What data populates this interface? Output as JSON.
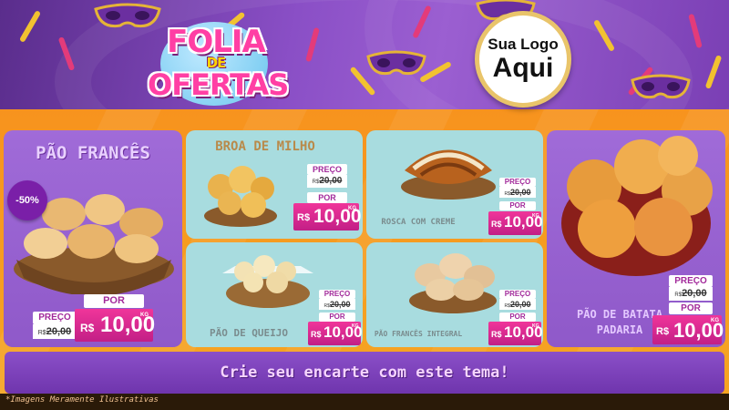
{
  "header": {
    "title_line1": "FOLIA",
    "title_line2": "DE",
    "title_line3": "OFERTAS",
    "logo_line1": "Sua Logo",
    "logo_line2": "Aqui"
  },
  "products": [
    {
      "name": "PÃO FRANCÊS",
      "badge": "-50%",
      "old_label": "PREÇO",
      "old_currency": "R$",
      "old_value": "20,00",
      "new_label": "POR",
      "new_currency": "R$",
      "new_value": "10,00",
      "unit": "KG"
    },
    {
      "name": "BROA DE MILHO",
      "old_label": "PREÇO",
      "old_currency": "R$",
      "old_value": "20,00",
      "new_label": "POR",
      "new_currency": "R$",
      "new_value": "10,00",
      "unit": "KG"
    },
    {
      "name": "ROSCA COM CREME",
      "old_label": "PREÇO",
      "old_currency": "R$",
      "old_value": "20,00",
      "new_label": "POR",
      "new_currency": "R$",
      "new_value": "10,00",
      "unit": "KG"
    },
    {
      "name": "PÃO DE QUEIJO",
      "old_label": "PREÇO",
      "old_currency": "R$",
      "old_value": "20,00",
      "new_label": "POR",
      "new_currency": "R$",
      "new_value": "10,00",
      "unit": "KG"
    },
    {
      "name": "PÃO FRANCÊS INTEGRAL",
      "old_label": "PREÇO",
      "old_currency": "R$",
      "old_value": "20,00",
      "new_label": "POR",
      "new_currency": "R$",
      "new_value": "10,00",
      "unit": "KG"
    },
    {
      "name_line1": "PÃO DE BATATA",
      "name_line2": "PADARIA",
      "old_label": "PREÇO",
      "old_currency": "R$",
      "old_value": "20,00",
      "new_label": "POR",
      "new_currency": "R$",
      "new_value": "10,00",
      "unit": "KG"
    }
  ],
  "cta": {
    "text": "Crie seu encarte com este tema!"
  },
  "footer": {
    "note": "*Imagens Meramente Ilustrativas"
  },
  "colors": {
    "banner_purple": "#8a4fc6",
    "card_purple": "#9a63d3",
    "card_teal": "#a8dcdf",
    "accent_pink": "#e8288f",
    "accent_orange": "#f5a623"
  },
  "icons": [
    "carnival-mask-icon",
    "streamer-icon",
    "bread-basket-icon"
  ]
}
